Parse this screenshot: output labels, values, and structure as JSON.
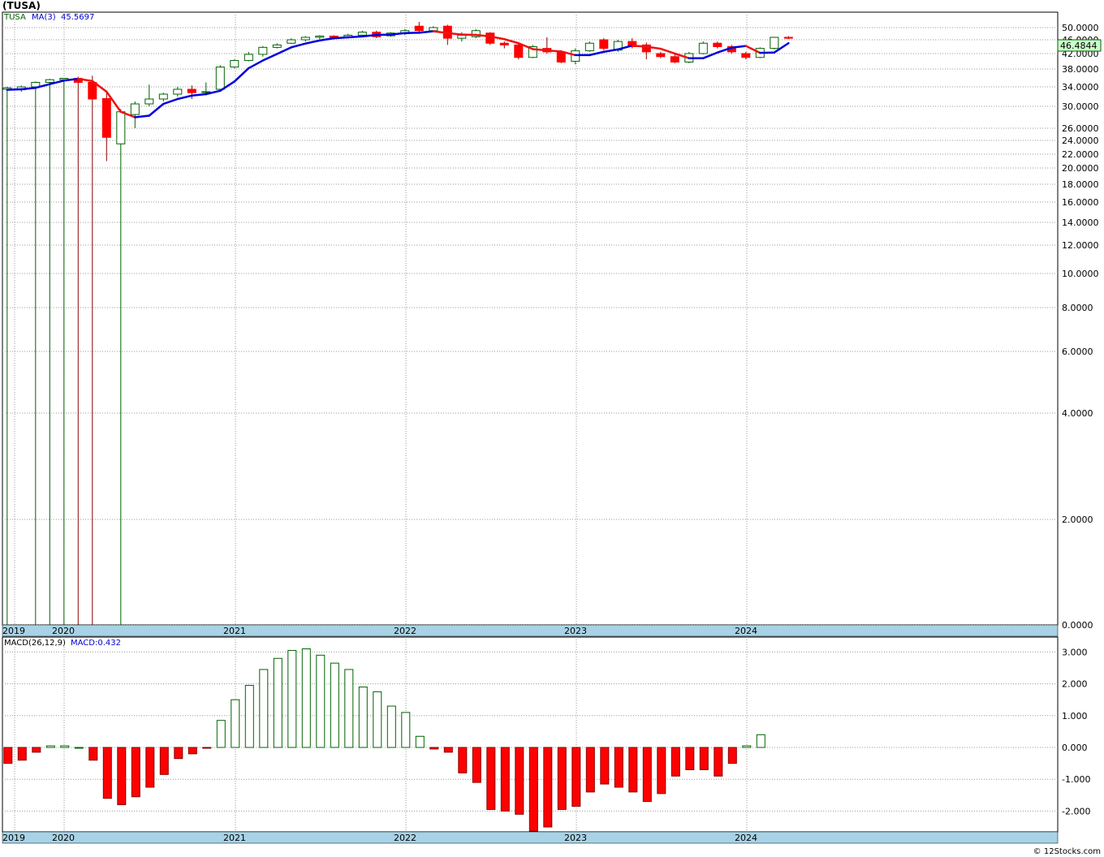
{
  "title": "(TUSA)",
  "footer": "© 12Stocks.com",
  "price_panel": {
    "legend": {
      "ticker": "TUSA",
      "ma_label": "MA(3)",
      "ma_value": "45.5697"
    },
    "last_price_label": "46.4844"
  },
  "macd_panel": {
    "legend": {
      "label": "MACD(26,12,9)",
      "value_label": "MACD:0.432"
    }
  },
  "colors": {
    "up": "#006400",
    "down": "#ff0000",
    "ma_up": "#0000dd",
    "ma_down": "#ee1111",
    "axis_band": "#a8d3e6",
    "grid": "#999999",
    "price_badge": "#ccffcc"
  },
  "chart_data": [
    {
      "type": "candlestick",
      "title": "(TUSA)",
      "interval": "monthly",
      "scale": "custom",
      "grid": true,
      "x_labels": [
        "2019",
        "2020",
        "2021",
        "2022",
        "2023",
        "2024"
      ],
      "y_ticks": [
        "50.0000",
        "46.0000",
        "42.0000",
        "38.0000",
        "34.0000",
        "30.0000",
        "26.0000",
        "24.0000",
        "22.0000",
        "20.0000",
        "18.0000",
        "16.0000",
        "14.0000",
        "12.0000",
        "10.0000",
        "8.0000",
        "6.0000",
        "4.0000",
        "2.0000",
        "0.0000"
      ],
      "candles": [
        {
          "o": 33.5,
          "h": 34.0,
          "l": 0,
          "c": 33.8
        },
        {
          "o": 33.4,
          "h": 34.3,
          "l": 33.0,
          "c": 34.0
        },
        {
          "o": 34.0,
          "h": 35.2,
          "l": 0,
          "c": 35.0
        },
        {
          "o": 35.0,
          "h": 35.8,
          "l": 0,
          "c": 35.6
        },
        {
          "o": 35.6,
          "h": 36.0,
          "l": 0,
          "c": 35.9
        },
        {
          "o": 35.9,
          "h": 36.3,
          "l": 0,
          "c": 35.0
        },
        {
          "o": 35.0,
          "h": 36.5,
          "l": 0,
          "c": 31.5
        },
        {
          "o": 31.6,
          "h": 33.0,
          "l": 21.0,
          "c": 24.5
        },
        {
          "o": 23.5,
          "h": 29.5,
          "l": 0,
          "c": 29.0
        },
        {
          "o": 28.5,
          "h": 31.0,
          "l": 26.0,
          "c": 30.5
        },
        {
          "o": 30.5,
          "h": 34.5,
          "l": 30.0,
          "c": 31.5
        },
        {
          "o": 31.5,
          "h": 32.8,
          "l": 31.0,
          "c": 32.5
        },
        {
          "o": 32.5,
          "h": 34.0,
          "l": 32.0,
          "c": 33.5
        },
        {
          "o": 33.5,
          "h": 34.3,
          "l": 31.5,
          "c": 32.8
        },
        {
          "o": 33.0,
          "h": 35.0,
          "l": 32.5,
          "c": 33.0
        },
        {
          "o": 33.5,
          "h": 39.0,
          "l": 33.3,
          "c": 38.5
        },
        {
          "o": 38.5,
          "h": 40.5,
          "l": 38.2,
          "c": 40.2
        },
        {
          "o": 40.2,
          "h": 42.5,
          "l": 40.0,
          "c": 41.8
        },
        {
          "o": 41.8,
          "h": 44.2,
          "l": 41.2,
          "c": 43.8
        },
        {
          "o": 43.8,
          "h": 45.0,
          "l": 43.5,
          "c": 44.5
        },
        {
          "o": 45.0,
          "h": 46.5,
          "l": 44.8,
          "c": 46.0
        },
        {
          "o": 46.0,
          "h": 47.2,
          "l": 45.5,
          "c": 46.8
        },
        {
          "o": 46.8,
          "h": 47.5,
          "l": 46.2,
          "c": 47.2
        },
        {
          "o": 47.2,
          "h": 47.5,
          "l": 46.5,
          "c": 46.8
        },
        {
          "o": 47.0,
          "h": 48.0,
          "l": 46.5,
          "c": 47.5
        },
        {
          "o": 47.5,
          "h": 49.0,
          "l": 47.0,
          "c": 48.5
        },
        {
          "o": 48.5,
          "h": 49.0,
          "l": 46.5,
          "c": 47.0
        },
        {
          "o": 47.3,
          "h": 48.5,
          "l": 47.0,
          "c": 48.2
        },
        {
          "o": 48.0,
          "h": 49.5,
          "l": 47.5,
          "c": 49.0
        },
        {
          "o": 50.5,
          "h": 52.0,
          "l": 48.5,
          "c": 49.0
        },
        {
          "o": 49.0,
          "h": 50.5,
          "l": 48.5,
          "c": 50.0
        },
        {
          "o": 50.5,
          "h": 51.0,
          "l": 44.5,
          "c": 46.5
        },
        {
          "o": 46.5,
          "h": 48.5,
          "l": 45.5,
          "c": 47.5
        },
        {
          "o": 47.0,
          "h": 49.5,
          "l": 46.5,
          "c": 49.0
        },
        {
          "o": 48.2,
          "h": 48.5,
          "l": 44.5,
          "c": 45.0
        },
        {
          "o": 45.0,
          "h": 45.5,
          "l": 43.5,
          "c": 44.5
        },
        {
          "o": 44.5,
          "h": 45.2,
          "l": 40.5,
          "c": 41.0
        },
        {
          "o": 41.0,
          "h": 44.5,
          "l": 40.8,
          "c": 44.0
        },
        {
          "o": 43.5,
          "h": 46.8,
          "l": 42.0,
          "c": 42.5
        },
        {
          "o": 42.5,
          "h": 43.0,
          "l": 39.5,
          "c": 39.8
        },
        {
          "o": 40.0,
          "h": 43.5,
          "l": 39.2,
          "c": 42.8
        },
        {
          "o": 42.8,
          "h": 45.5,
          "l": 42.5,
          "c": 45.0
        },
        {
          "o": 46.0,
          "h": 46.5,
          "l": 43.0,
          "c": 43.5
        },
        {
          "o": 43.0,
          "h": 46.0,
          "l": 42.5,
          "c": 45.5
        },
        {
          "o": 45.5,
          "h": 46.5,
          "l": 43.5,
          "c": 44.0
        },
        {
          "o": 44.5,
          "h": 45.2,
          "l": 40.5,
          "c": 42.5
        },
        {
          "o": 42.0,
          "h": 42.5,
          "l": 40.8,
          "c": 41.2
        },
        {
          "o": 41.2,
          "h": 41.8,
          "l": 39.5,
          "c": 39.8
        },
        {
          "o": 39.8,
          "h": 42.5,
          "l": 39.5,
          "c": 42.0
        },
        {
          "o": 42.0,
          "h": 45.5,
          "l": 41.8,
          "c": 45.0
        },
        {
          "o": 45.0,
          "h": 45.5,
          "l": 43.5,
          "c": 44.0
        },
        {
          "o": 44.0,
          "h": 44.5,
          "l": 42.0,
          "c": 42.5
        },
        {
          "o": 42.0,
          "h": 42.5,
          "l": 40.5,
          "c": 41.0
        },
        {
          "o": 41.0,
          "h": 43.8,
          "l": 40.8,
          "c": 43.5
        },
        {
          "o": 43.5,
          "h": 47.0,
          "l": 43.2,
          "c": 46.8
        },
        {
          "o": 46.8,
          "h": 47.2,
          "l": 46.2,
          "c": 46.5
        }
      ],
      "ma3": [
        33.4,
        33.5,
        33.8,
        34.6,
        35.4,
        35.8,
        35.3,
        33.0,
        29.0,
        28.0,
        28.3,
        30.5,
        31.5,
        32.2,
        32.5,
        33.2,
        35.2,
        38.2,
        40.2,
        41.9,
        43.8,
        44.9,
        45.8,
        46.5,
        46.8,
        47.1,
        47.6,
        47.7,
        48.2,
        48.3,
        48.8,
        48.2,
        47.7,
        47.6,
        47.1,
        46.2,
        45.0,
        43.3,
        42.9,
        42.6,
        41.6,
        41.6,
        42.5,
        43.2,
        44.3,
        44.0,
        43.4,
        42.0,
        40.8,
        40.8,
        42.3,
        43.7,
        44.2,
        42.2,
        42.3,
        45.0
      ],
      "last_price": 46.4844
    },
    {
      "type": "bar",
      "title": "MACD(26,12,9)",
      "grid": true,
      "y_ticks": [
        "3.000",
        "2.000",
        "1.000",
        "0.000",
        "-1.000",
        "-2.000"
      ],
      "ylim": [
        -2.7,
        3.2
      ],
      "x_labels": [
        "2019",
        "2020",
        "2021",
        "2022",
        "2023",
        "2024"
      ],
      "values": [
        -0.5,
        -0.4,
        -0.15,
        0.05,
        0.05,
        0.0,
        -0.4,
        -1.6,
        -1.8,
        -1.55,
        -1.25,
        -0.85,
        -0.35,
        -0.2,
        -0.02,
        0.85,
        1.5,
        1.95,
        2.45,
        2.8,
        3.05,
        3.1,
        2.9,
        2.65,
        2.45,
        1.9,
        1.75,
        1.3,
        1.1,
        0.35,
        -0.05,
        -0.15,
        -0.8,
        -1.1,
        -1.95,
        -2.0,
        -2.1,
        -2.65,
        -2.5,
        -1.95,
        -1.85,
        -1.4,
        -1.15,
        -1.25,
        -1.4,
        -1.7,
        -1.45,
        -0.9,
        -0.7,
        -0.7,
        -0.9,
        -0.5,
        0.05,
        0.4
      ],
      "current_value": 0.432
    }
  ]
}
